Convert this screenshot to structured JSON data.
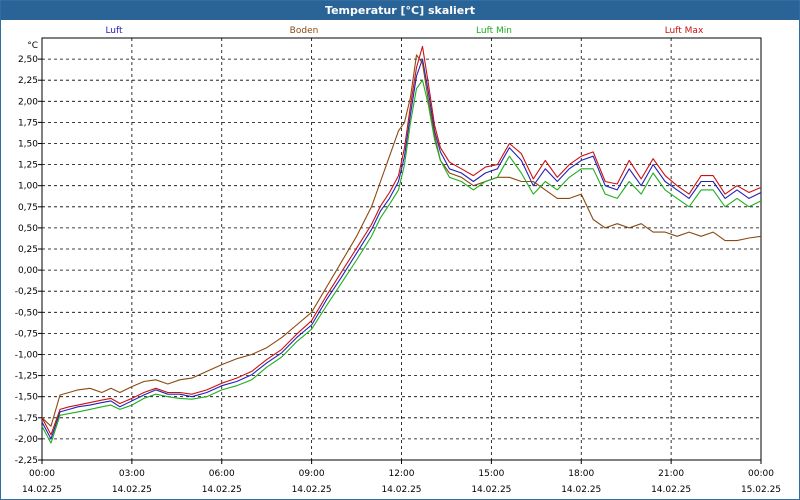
{
  "window": {
    "title": "Temperatur [°C] skaliert"
  },
  "chart_data": {
    "type": "line",
    "title": "Temperatur [°C] skaliert",
    "ylabel": "°C",
    "xlabel": "",
    "ylim": [
      -2.25,
      2.75
    ],
    "xlim": [
      0,
      24
    ],
    "y_ticks": [
      "2,50",
      "2,25",
      "2,00",
      "1,75",
      "1,50",
      "1,25",
      "1,00",
      "0,75",
      "0,50",
      "0,25",
      "0,00",
      "-0,25",
      "-0,50",
      "-0,75",
      "-1,00",
      "-1,25",
      "-1,50",
      "-1,75",
      "-2,00",
      "-2,25"
    ],
    "x_ticks": [
      {
        "time": "00:00",
        "date": "14.02.25"
      },
      {
        "time": "03:00",
        "date": "14.02.25"
      },
      {
        "time": "06:00",
        "date": "14.02.25"
      },
      {
        "time": "09:00",
        "date": "14.02.25"
      },
      {
        "time": "12:00",
        "date": "14.02.25"
      },
      {
        "time": "15:00",
        "date": "14.02.25"
      },
      {
        "time": "18:00",
        "date": "14.02.25"
      },
      {
        "time": "21:00",
        "date": "14.02.25"
      },
      {
        "time": "00:00",
        "date": "15.02.25"
      }
    ],
    "grid": true,
    "legend_position": "top",
    "x_hours": [
      0,
      0.3,
      0.6,
      0.9,
      1.2,
      1.6,
      2,
      2.3,
      2.6,
      3,
      3.4,
      3.8,
      4.2,
      4.6,
      5,
      5.5,
      6,
      6.5,
      7,
      7.5,
      8,
      8.5,
      9,
      9.5,
      10,
      10.5,
      11,
      11.3,
      11.6,
      11.9,
      12.1,
      12.3,
      12.5,
      12.7,
      12.9,
      13.1,
      13.3,
      13.6,
      14,
      14.4,
      14.8,
      15.2,
      15.6,
      16,
      16.4,
      16.8,
      17.2,
      17.6,
      18,
      18.4,
      18.8,
      19.2,
      19.6,
      20,
      20.4,
      20.8,
      21.2,
      21.6,
      22,
      22.4,
      22.8,
      23.2,
      23.6,
      24
    ],
    "series": [
      {
        "name": "Luft",
        "color": "#2222bb",
        "values": [
          -1.8,
          -2.0,
          -1.68,
          -1.65,
          -1.62,
          -1.6,
          -1.57,
          -1.55,
          -1.62,
          -1.55,
          -1.48,
          -1.42,
          -1.47,
          -1.47,
          -1.5,
          -1.45,
          -1.37,
          -1.32,
          -1.24,
          -1.1,
          -0.98,
          -0.8,
          -0.65,
          -0.35,
          -0.08,
          0.2,
          0.48,
          0.7,
          0.85,
          1.05,
          1.35,
          1.85,
          2.3,
          2.5,
          2.1,
          1.65,
          1.4,
          1.2,
          1.15,
          1.05,
          1.15,
          1.2,
          1.45,
          1.3,
          1.0,
          1.2,
          1.05,
          1.2,
          1.3,
          1.35,
          1.0,
          0.95,
          1.2,
          1.0,
          1.25,
          1.05,
          0.95,
          0.85,
          1.05,
          1.05,
          0.85,
          0.95,
          0.85,
          0.92
        ]
      },
      {
        "name": "Boden",
        "color": "#8b4a10",
        "values": [
          -1.75,
          -1.85,
          -1.48,
          -1.45,
          -1.42,
          -1.4,
          -1.45,
          -1.4,
          -1.45,
          -1.38,
          -1.32,
          -1.3,
          -1.35,
          -1.3,
          -1.28,
          -1.2,
          -1.12,
          -1.05,
          -1.0,
          -0.92,
          -0.8,
          -0.65,
          -0.5,
          -0.2,
          0.1,
          0.4,
          0.75,
          1.05,
          1.35,
          1.65,
          1.75,
          2.05,
          2.55,
          2.45,
          2.0,
          1.6,
          1.3,
          1.15,
          1.1,
          1.0,
          1.05,
          1.1,
          1.1,
          1.05,
          1.05,
          0.95,
          0.85,
          0.85,
          0.9,
          0.6,
          0.5,
          0.55,
          0.5,
          0.55,
          0.45,
          0.45,
          0.4,
          0.45,
          0.4,
          0.45,
          0.35,
          0.35,
          0.38,
          0.4
        ]
      },
      {
        "name": "Luft Min",
        "color": "#1fae1f",
        "values": [
          -1.85,
          -2.05,
          -1.72,
          -1.7,
          -1.68,
          -1.65,
          -1.62,
          -1.6,
          -1.65,
          -1.6,
          -1.52,
          -1.47,
          -1.5,
          -1.52,
          -1.53,
          -1.5,
          -1.42,
          -1.37,
          -1.3,
          -1.15,
          -1.03,
          -0.85,
          -0.7,
          -0.42,
          -0.15,
          0.12,
          0.4,
          0.62,
          0.78,
          0.95,
          1.25,
          1.75,
          2.15,
          2.25,
          1.95,
          1.55,
          1.3,
          1.1,
          1.05,
          0.95,
          1.05,
          1.1,
          1.35,
          1.15,
          0.9,
          1.05,
          0.95,
          1.1,
          1.2,
          1.2,
          0.9,
          0.85,
          1.05,
          0.9,
          1.15,
          0.95,
          0.85,
          0.75,
          0.95,
          0.95,
          0.75,
          0.85,
          0.75,
          0.82
        ]
      },
      {
        "name": "Luft Max",
        "color": "#cc1111",
        "values": [
          -1.75,
          -1.95,
          -1.65,
          -1.62,
          -1.6,
          -1.57,
          -1.54,
          -1.52,
          -1.58,
          -1.52,
          -1.45,
          -1.4,
          -1.45,
          -1.45,
          -1.47,
          -1.42,
          -1.34,
          -1.28,
          -1.2,
          -1.06,
          -0.94,
          -0.76,
          -0.6,
          -0.3,
          -0.02,
          0.26,
          0.54,
          0.76,
          0.92,
          1.12,
          1.45,
          1.95,
          2.4,
          2.65,
          2.2,
          1.72,
          1.45,
          1.28,
          1.2,
          1.12,
          1.22,
          1.25,
          1.5,
          1.38,
          1.08,
          1.3,
          1.1,
          1.25,
          1.35,
          1.4,
          1.05,
          1.02,
          1.3,
          1.08,
          1.32,
          1.12,
          1.0,
          0.9,
          1.12,
          1.12,
          0.9,
          1.0,
          0.92,
          0.98
        ]
      }
    ]
  }
}
